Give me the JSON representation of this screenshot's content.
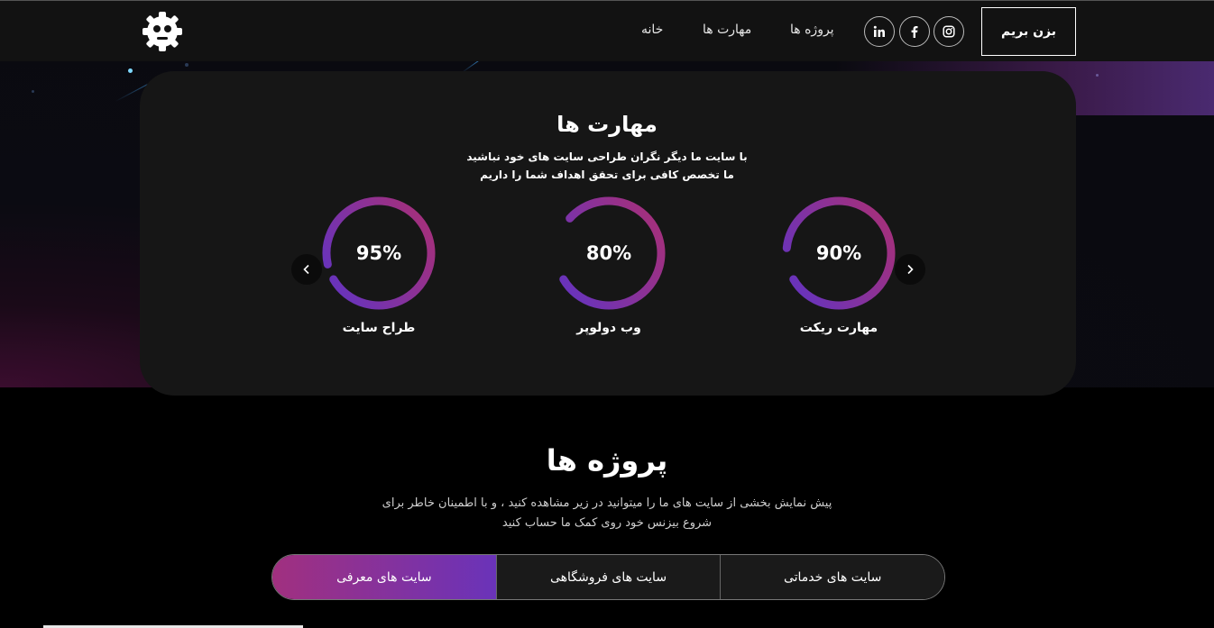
{
  "header": {
    "logo_icon": "robot-gear-icon",
    "nav": {
      "home": "خانه",
      "skills": "مهارت ها",
      "projects": "پروژه ها"
    },
    "social": [
      "linkedin-icon",
      "facebook-icon",
      "instagram-icon"
    ],
    "cta_label": "بزن بریم"
  },
  "skills": {
    "title": "مهارت ها",
    "subtitle_line1": "با سایت ما دیگر نگران طراحی سایت های خود نباشید",
    "subtitle_line2": "ما تخصص کافی برای تحقق اهداف شما را داریم",
    "items": [
      {
        "value": "95%",
        "label": "طراح سایت",
        "percent": 95
      },
      {
        "value": "80%",
        "label": "وب دولوپر",
        "percent": 80
      },
      {
        "value": "90%",
        "label": "مهارت ریکت",
        "percent": 90
      }
    ],
    "prev_icon": "chevron-left-icon",
    "next_icon": "chevron-right-icon"
  },
  "projects": {
    "title": "پروژه ها",
    "subtitle_line1": "پیش نمایش بخشی از سایت های ما را میتوانید در زیر مشاهده کنید ، و با اطمینان خاطر برای",
    "subtitle_line2": "شروع بیزنس خود روی کمک ما حساب کنید",
    "tabs": [
      "سایت های معرفی",
      "سایت های فروشگاهی",
      "سایت های خدماتی"
    ],
    "active_tab": 0
  },
  "colors": {
    "gradient_start": "#a1307f",
    "gradient_end": "#6a33b9"
  }
}
